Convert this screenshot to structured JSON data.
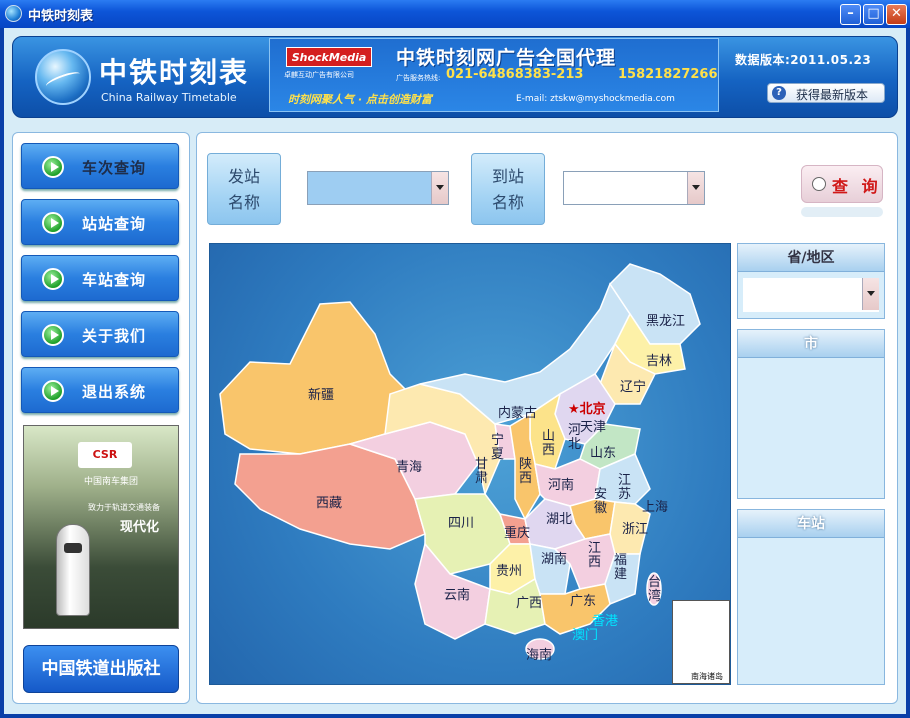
{
  "window": {
    "title": "中铁时刻表"
  },
  "header": {
    "brand_cn": "中铁时刻表",
    "brand_en": "China Railway Timetable",
    "version": "数据版本:2011.05.23",
    "update_button": "获得最新版本",
    "ad": {
      "logo": "ShockMedia",
      "company": "卓麒互动广告有限公司",
      "title": "中铁时刻网广告全国代理",
      "hotline_label": "广告服务热线:",
      "phone1": "021-64868383-213",
      "phone2": "15821827266",
      "slogan": "时刻网聚人气 · 点击创造财富",
      "email": "E-mail: ztskw@myshockmedia.com"
    }
  },
  "nav": {
    "items": [
      {
        "label": "车次查询"
      },
      {
        "label": "站站查询"
      },
      {
        "label": "车站查询"
      },
      {
        "label": "关于我们"
      },
      {
        "label": "退出系统"
      }
    ]
  },
  "promo": {
    "logo": "CSR",
    "group": "中国南车集团",
    "motto": "致力于轨道交通装备",
    "modern": "现代化"
  },
  "publisher": "中国铁道出版社",
  "search": {
    "from_label": "发站\n名称",
    "to_label": "到站\n名称",
    "query_button": "查 询"
  },
  "sidebar": {
    "province_header": "省/地区",
    "city_header": "市",
    "station_header": "车站"
  },
  "map": {
    "provinces": {
      "heilongjiang": "黑龙江",
      "jilin": "吉林",
      "liaoning": "辽宁",
      "neimenggu": "内蒙古",
      "beijing": "★北京",
      "tianjin": "天津",
      "hebei": "河北",
      "shanxi": "山西",
      "shandong": "山东",
      "ningxia": "宁夏",
      "xinjiang": "新疆",
      "qinghai": "青海",
      "gansu": "甘肃",
      "shaanxi": "陕西",
      "henan": "河南",
      "jiangsu": "江苏",
      "anhui": "安徽",
      "shanghai": "上海",
      "xizang": "西藏",
      "sichuan": "四川",
      "chongqing": "重庆",
      "hubei": "湖北",
      "zhejiang": "浙江",
      "guizhou": "贵州",
      "hunan": "湖南",
      "jiangxi": "江西",
      "fujian": "福建",
      "taiwan": "台湾",
      "yunnan": "云南",
      "guangxi": "广西",
      "guangdong": "广东",
      "xianggang": "香港",
      "aomen": "澳门",
      "hainan": "海南",
      "nanhai": "南海诸岛"
    }
  }
}
